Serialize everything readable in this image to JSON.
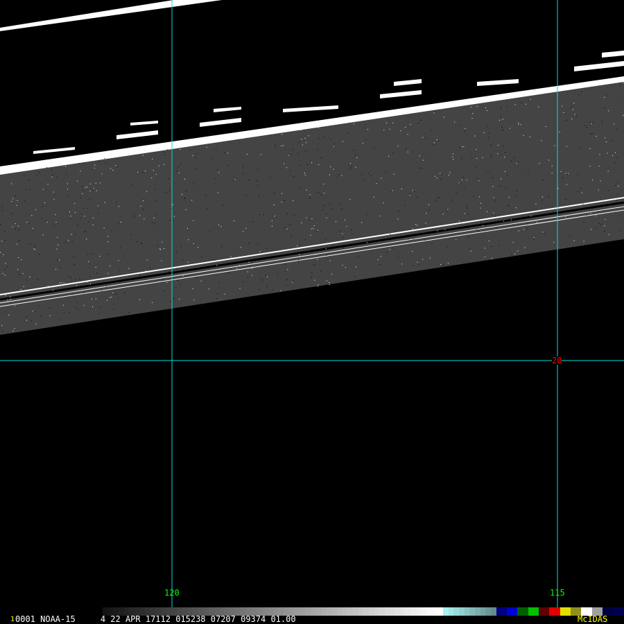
{
  "status_bar": {
    "frame_number": "1",
    "info": "0001 NOAA-15     4 22 APR 17112 015238 07207 09374 01.00",
    "brand": "McIDAS"
  },
  "grid_labels": {
    "lon_120": "120",
    "lon_115": "115",
    "lat_20": "20"
  },
  "colors": {
    "grid": "#00e0e0",
    "lon_label": "#00ff00",
    "lat_label": "#ff0000",
    "brand": "#ffff00",
    "swath": "#444444"
  }
}
